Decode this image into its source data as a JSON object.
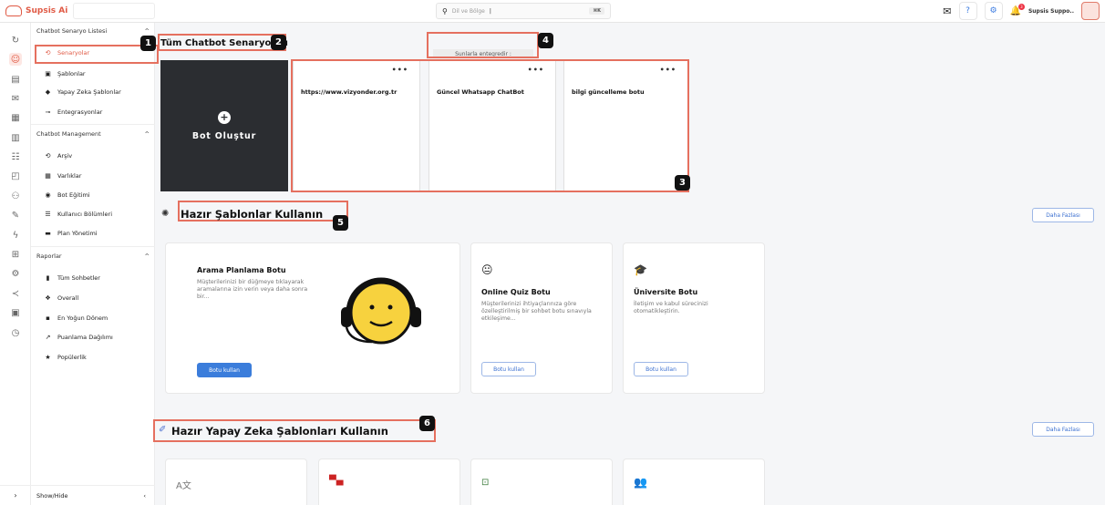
{
  "brand": {
    "name": "Supsis Ai"
  },
  "top_search": {
    "placeholder": "Dil ve Bölge",
    "shortcut": "⌘K"
  },
  "user": {
    "name": "Supsis Suppo..",
    "notification_count": "3"
  },
  "sidebar": {
    "sections": [
      {
        "title": "Chatbot Senaryo Listesi",
        "items": [
          {
            "label": "Senaryolar",
            "icon": "history-icon",
            "glyph": "⟲",
            "active": true
          },
          {
            "label": "Şablonlar",
            "icon": "template-icon",
            "glyph": "▣"
          },
          {
            "label": "Yapay Zeka Şablonlar",
            "icon": "ai-icon",
            "glyph": "◆"
          },
          {
            "label": "Entegrasyonlar",
            "icon": "key-icon",
            "glyph": "⊸"
          }
        ]
      },
      {
        "title": "Chatbot Management",
        "items": [
          {
            "label": "Arşiv",
            "icon": "archive-icon",
            "glyph": "⟲"
          },
          {
            "label": "Varlıklar",
            "icon": "grid-icon",
            "glyph": "▦"
          },
          {
            "label": "Bot Eğitimi",
            "icon": "training-icon",
            "glyph": "◉"
          },
          {
            "label": "Kullanıcı Bölümleri",
            "icon": "segments-icon",
            "glyph": "☰"
          },
          {
            "label": "Plan Yönetimi",
            "icon": "plan-icon",
            "glyph": "▬"
          }
        ]
      },
      {
        "title": "Raporlar",
        "items": [
          {
            "label": "Tüm Sohbetler",
            "icon": "chat-icon",
            "glyph": "▮"
          },
          {
            "label": "Overall",
            "icon": "overall-icon",
            "glyph": "❖"
          },
          {
            "label": "En Yoğun Dönem",
            "icon": "peak-icon",
            "glyph": "▪"
          },
          {
            "label": "Puanlama Dağılımı",
            "icon": "trend-icon",
            "glyph": "↗"
          },
          {
            "label": "Popülerlik",
            "icon": "star-icon",
            "glyph": "★"
          }
        ]
      }
    ],
    "bottom_label": "Show/Hide"
  },
  "annotations": [
    "1",
    "2",
    "3",
    "4",
    "5",
    "6"
  ],
  "scenarios": {
    "title": "Tüm Chatbot Senaryoları",
    "create_label": "Bot Oluştur",
    "integrations_label": "Sunlarla entegredir :",
    "bots": [
      {
        "name": "https://www.vizyonder.org.tr"
      },
      {
        "name": "Güncel Whatsapp ChatBot"
      },
      {
        "name": "bilgi güncelleme botu"
      }
    ]
  },
  "templates": {
    "title": "Hazır Şablonlar Kullanın",
    "more_label": "Daha Fazlası",
    "cards": [
      {
        "title": "Arama Planlama Botu",
        "desc": "Müşterilerinizi bir düğmeye tıklayarak aramalarına izin verin veya daha sonra bir...",
        "button": "Botu kullan"
      },
      {
        "title": "Online Quiz Botu",
        "desc": "Müşterilerinizi ihtiyaçlarınıza göre özelleştirilmiş bir sohbet botu sınavıyla etkileşime...",
        "button": "Botu kullan"
      },
      {
        "title": "Üniversite Botu",
        "desc": "İletişim ve kabul sürecinizi otomatikleştirin.",
        "button": "Botu kullan"
      }
    ]
  },
  "ai_templates": {
    "title": "Hazır Yapay Zeka Şablonları Kullanın",
    "more_label": "Daha Fazlası"
  }
}
